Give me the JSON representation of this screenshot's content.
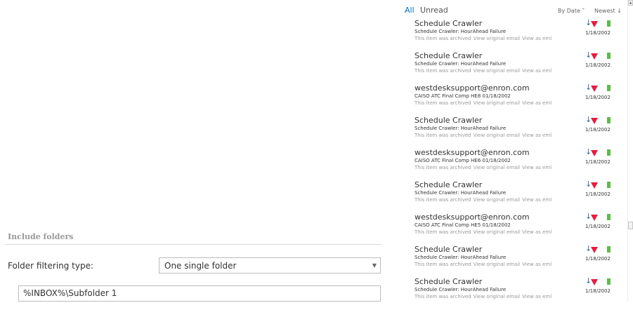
{
  "settings": {
    "section_header": "Include folders",
    "filter_label": "Folder filtering type:",
    "filter_value": "One single folder",
    "folder_path": "%INBOX%\\Subfolder 1"
  },
  "mail": {
    "tab_all": "All",
    "tab_unread": "Unread",
    "sort_by": "By Date ˅",
    "sort_order": "Newest ↓",
    "archived_text": "This item was archived",
    "view_original": "View original email",
    "view_eml": "View as eml",
    "items": [
      {
        "from": "Schedule Crawler",
        "subject": "Schedule Crawler: HourAhead Failure",
        "date": "1/18/2002"
      },
      {
        "from": "Schedule Crawler",
        "subject": "Schedule Crawler: HourAhead Failure",
        "date": "1/18/2002"
      },
      {
        "from": "westdesksupport@enron.com",
        "subject": "CAISO ATC Final Comp HE8 01/18/2002",
        "date": "1/18/2002"
      },
      {
        "from": "Schedule Crawler",
        "subject": "Schedule Crawler: HourAhead Failure",
        "date": "1/18/2002"
      },
      {
        "from": "westdesksupport@enron.com",
        "subject": "CAISO ATC Final Comp HE6 01/18/2002",
        "date": "1/18/2002"
      },
      {
        "from": "Schedule Crawler",
        "subject": "Schedule Crawler: HourAhead Failure",
        "date": "1/18/2002"
      },
      {
        "from": "westdesksupport@enron.com",
        "subject": "CAISO ATC Final Comp HE5 01/18/2002",
        "date": "1/18/2002"
      },
      {
        "from": "Schedule Crawler",
        "subject": "Schedule Crawler: HourAhead Failure",
        "date": "1/18/2002"
      },
      {
        "from": "Schedule Crawler",
        "subject": "Schedule Crawler: HourAhead Failure",
        "date": "1/18/2002"
      }
    ]
  },
  "colors": {
    "accent": "#0072c6",
    "flag": "#e81c3c",
    "category": "#5fbb46",
    "arrow": "#1d6fc9"
  },
  "icons": {
    "arrow": "down-arrow-icon",
    "flag": "flag-icon",
    "category": "category-icon",
    "select_arrow": "chevron-down-icon"
  }
}
